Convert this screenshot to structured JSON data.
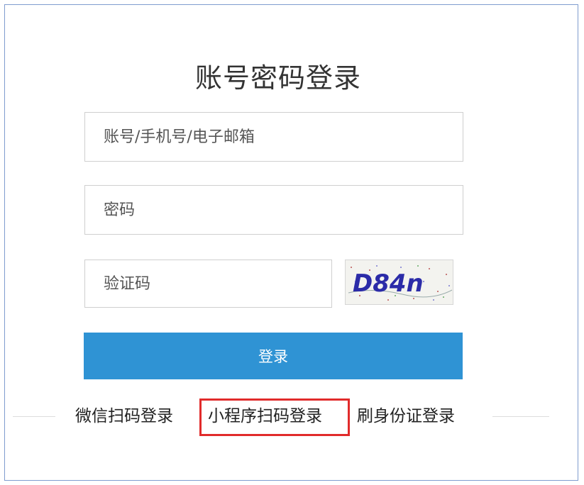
{
  "title": "账号密码登录",
  "form": {
    "account_placeholder": "账号/手机号/电子邮箱",
    "password_placeholder": "密码",
    "captcha_placeholder": "验证码",
    "captcha_text": "D84n",
    "login_label": "登录"
  },
  "alt_logins": [
    {
      "label": "微信扫码登录"
    },
    {
      "label": "小程序扫码登录",
      "highlighted": true
    },
    {
      "label": "刷身份证登录"
    }
  ],
  "colors": {
    "panel_border": "#7f9ccf",
    "button": "#2f93d4",
    "highlight": "#e12b2b",
    "captcha_text": "#2b2ba8"
  }
}
